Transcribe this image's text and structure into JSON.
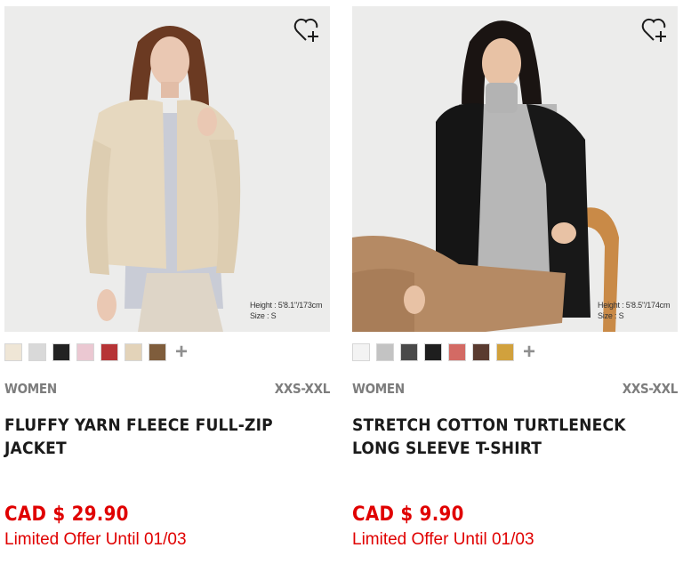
{
  "products": [
    {
      "model_info": {
        "height": "Height : 5'8.1\"/173cm",
        "size": "Size : S"
      },
      "swatches": [
        "#efe6d6",
        "#d9d9d9",
        "#222222",
        "#ebc8d2",
        "#b63436",
        "#e3d3b9",
        "#7f5d3c"
      ],
      "more_label": "+",
      "gender": "WOMEN",
      "sizes": "XXS-XXL",
      "name": "FLUFFY YARN FLEECE FULL-ZIP JACKET",
      "price": "CAD $ 29.90",
      "offer": "Limited Offer Until 01/03"
    },
    {
      "model_info": {
        "height": "Height : 5'8.5\"/174cm",
        "size": "Size : S"
      },
      "swatches": [
        "#f3f3f3",
        "#c3c3c3",
        "#4a4a4a",
        "#1e1e1e",
        "#d36a64",
        "#5a3b30",
        "#d1a13d"
      ],
      "more_label": "+",
      "gender": "WOMEN",
      "sizes": "XXS-XXL",
      "name": "STRETCH COTTON TURTLENECK LONG SLEEVE T-SHIRT",
      "price": "CAD $ 9.90",
      "offer": "Limited Offer Until 01/03"
    }
  ],
  "icons": {
    "wishlist": "heart-plus-icon",
    "more_colors": "plus-icon"
  },
  "colors": {
    "price": "#e00000",
    "muted": "#7d7d7d",
    "text": "#1b1b1b"
  }
}
